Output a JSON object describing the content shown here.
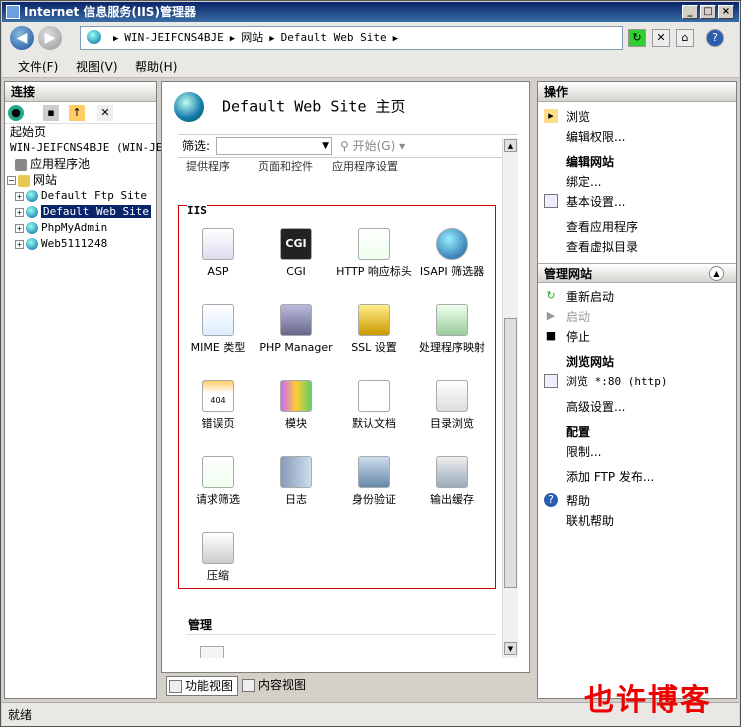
{
  "window": {
    "title": "Internet 信息服务(IIS)管理器"
  },
  "address": {
    "segments": [
      "WIN-JEIFCNS4BJE",
      "网站",
      "Default Web Site"
    ]
  },
  "menu": [
    {
      "label": "文件(F)"
    },
    {
      "label": "视图(V)"
    },
    {
      "label": "帮助(H)"
    }
  ],
  "connections": {
    "title": "连接",
    "tree": {
      "start": "起始页",
      "server": "WIN-JEIFCNS4BJE (WIN-JEI",
      "apppools": "应用程序池",
      "sites": "网站",
      "site_items": [
        "Default Ftp Site",
        "Default Web Site",
        "PhpMyAdmin",
        "Web5111248"
      ]
    }
  },
  "center": {
    "title": "Default Web Site 主页",
    "filter_label": "筛选:",
    "start_label": "开始(G)",
    "cut_labels": [
      "提供程序",
      "页面和控件",
      "应用程序设置"
    ],
    "group_title": "IIS",
    "features": [
      "ASP",
      "CGI",
      "HTTP 响应标头",
      "ISAPI 筛选器",
      "MIME 类型",
      "PHP Manager",
      "SSL 设置",
      "处理程序映射",
      "错误页",
      "模块",
      "默认文档",
      "目录浏览",
      "请求筛选",
      "日志",
      "身份验证",
      "输出缓存",
      "压缩"
    ],
    "management_title": "管理",
    "view_tabs": [
      "功能视图",
      "内容视图"
    ]
  },
  "actions": {
    "title": "操作",
    "browse": "浏览",
    "edit_perms": "编辑权限...",
    "edit_site": "编辑网站",
    "bindings": "绑定...",
    "basic_settings": "基本设置...",
    "view_apps": "查看应用程序",
    "view_vdirs": "查看虚拟目录",
    "manage_site": "管理网站",
    "restart": "重新启动",
    "start": "启动",
    "stop": "停止",
    "browse_site": "浏览网站",
    "browse_80": "浏览 *:80 (http)",
    "advanced": "高级设置...",
    "config": "配置",
    "limits": "限制...",
    "add_ftp": "添加 FTP 发布...",
    "help": "帮助",
    "online_help": "联机帮助"
  },
  "status": {
    "text": "就绪"
  },
  "watermark": {
    "text": "也许博客"
  }
}
